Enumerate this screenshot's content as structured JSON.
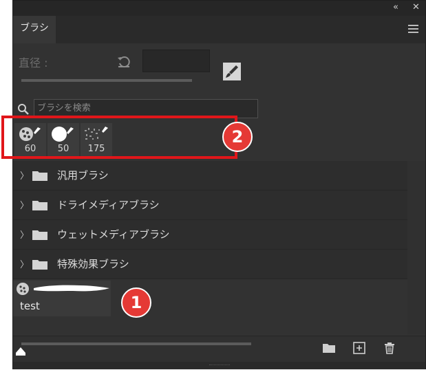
{
  "panel": {
    "title_tab": "ブラシ",
    "top_controls": {
      "collapse": "«",
      "close": "✕"
    }
  },
  "diameter": {
    "label": "直径 :",
    "value": ""
  },
  "search": {
    "placeholder": "ブラシを検索"
  },
  "recent_brushes": [
    {
      "size": "60"
    },
    {
      "size": "50"
    },
    {
      "size": "175"
    }
  ],
  "groups": [
    {
      "label": "汎用ブラシ"
    },
    {
      "label": "ドライメディアブラシ"
    },
    {
      "label": "ウェットメディアブラシ"
    },
    {
      "label": "特殊効果ブラシ"
    }
  ],
  "custom_brush": {
    "name": "test"
  },
  "annotations": [
    {
      "number": "1",
      "color": "#e53935"
    },
    {
      "number": "2",
      "color": "#e53935"
    }
  ],
  "colors": {
    "panel_bg": "#323232",
    "highlight": "#e0161a"
  }
}
